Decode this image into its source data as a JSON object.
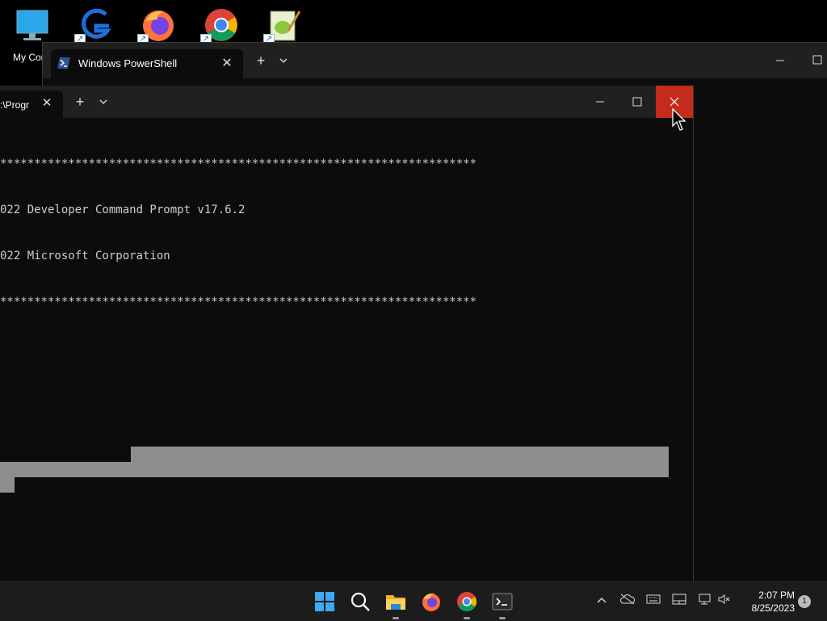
{
  "desktop": {
    "icons": [
      {
        "name": "monitor-icon",
        "label": "My Comp"
      },
      {
        "name": "gstarcad-icon",
        "label": ""
      },
      {
        "name": "firefox-icon",
        "label": ""
      },
      {
        "name": "chrome-icon",
        "label": ""
      },
      {
        "name": "notepad-plus-icon",
        "label": ""
      }
    ]
  },
  "back_window": {
    "tab_title": "Windows PowerShell",
    "tab_close": "✕",
    "new_tab": "+",
    "dropdown": "⌄"
  },
  "front_window": {
    "tab_title": ":\\Progr",
    "tab_close": "✕",
    "new_tab": "+",
    "dropdown": "⌄",
    "console_lines": [
      "**********************************************************************",
      "022 Developer Command Prompt v17.6.2",
      "022 Microsoft Corporation",
      "**********************************************************************"
    ]
  },
  "taskbar": {
    "apps": [
      "start-icon",
      "search-icon",
      "file-explorer-icon",
      "firefox-icon",
      "chrome-icon",
      "terminal-icon"
    ],
    "time": "2:07 PM",
    "date": "8/25/2023",
    "notification_count": "1"
  },
  "colors": {
    "close_hover": "#c42b1c",
    "console_bg": "#0c0c0c",
    "titlebar_bg": "#202020",
    "selection": "#8e8e8e"
  }
}
